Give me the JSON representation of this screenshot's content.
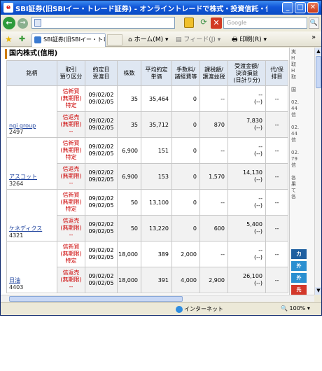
{
  "window": {
    "title": "SBI証券(旧SBIイー・トレード証券) - オンライントレードで株式・投資信託・債券を - Wind...",
    "app_icon": "e"
  },
  "address_bar": {
    "url": "",
    "search_placeholder": "Google",
    "refresh_glyph": "⟳",
    "stop_glyph": "✕",
    "search_go_glyph": "🔍"
  },
  "toolbar": {
    "tab_label": "SBI証券(旧SBIイー・トレー...",
    "home_label": "ホーム(M)",
    "feed_label": "フィード(J)",
    "print_label": "印刷(R)",
    "more_glyph": "»"
  },
  "section_title": "国内株式(信用)",
  "table": {
    "headers": [
      "銘柄",
      "取引\n預り区分",
      "約定日\n受渡日",
      "株数",
      "平均約定\n単価",
      "手数料/\n諸経費等",
      "課税額/\n譲渡益税",
      "受渡金額/\n決済損益\n(日計り分)",
      "代/保\n排目"
    ],
    "rows": [
      {
        "name": "ngi group",
        "code": "2497",
        "kind": "信新買\n(無期限)\n特定",
        "dates": "09/02/02\n09/02/05",
        "shares": "35",
        "price": "35,464",
        "fee": "0",
        "tax": "--",
        "settle": "--\n(--)",
        "flag": "--"
      },
      {
        "name": "",
        "code": "",
        "kind": "信返売\n(無期限)\n--",
        "dates": "09/02/02\n09/02/05",
        "shares": "35",
        "price": "35,712",
        "fee": "0",
        "tax": "870",
        "settle": "7,830\n(--)",
        "flag": "--"
      },
      {
        "name": "アスコット",
        "code": "3264",
        "kind": "信新買\n(無期限)\n特定",
        "dates": "09/02/02\n09/02/05",
        "shares": "6,900",
        "price": "151",
        "fee": "0",
        "tax": "--",
        "settle": "--\n(--)",
        "flag": "--"
      },
      {
        "name": "",
        "code": "",
        "kind": "信返売\n(無期限)\n--",
        "dates": "09/02/02\n09/02/05",
        "shares": "6,900",
        "price": "153",
        "fee": "0",
        "tax": "1,570",
        "settle": "14,130\n(--)",
        "flag": "--"
      },
      {
        "name": "ケネディクス",
        "code": "4321",
        "kind": "信新買\n(無期限)\n特定",
        "dates": "09/02/02\n09/02/05",
        "shares": "50",
        "price": "13,100",
        "fee": "0",
        "tax": "--",
        "settle": "--\n(--)",
        "flag": "--"
      },
      {
        "name": "",
        "code": "",
        "kind": "信返売\n(無期限)\n--",
        "dates": "09/02/02\n09/02/05",
        "shares": "50",
        "price": "13,220",
        "fee": "0",
        "tax": "600",
        "settle": "5,400\n(--)",
        "flag": "--"
      },
      {
        "name": "日油",
        "code": "4403",
        "kind": "信新買\n(無期限)\n特定",
        "dates": "09/02/02\n09/02/05",
        "shares": "18,000",
        "price": "389",
        "fee": "2,000",
        "tax": "--",
        "settle": "--\n(--)",
        "flag": "--"
      },
      {
        "name": "",
        "code": "",
        "kind": "信返売\n(無期限)\n--",
        "dates": "09/02/02\n09/02/05",
        "shares": "18,000",
        "price": "391",
        "fee": "4,000",
        "tax": "2,900",
        "settle": "26,100\n(--)",
        "flag": "--"
      }
    ]
  },
  "side_panel": {
    "text": "実\nH\n取\nH\n取\n\n国\n\n02.\n44\n信\n\n02.\n44\n信\n\n02.\n79\n信\n\n各\n果\nて\n各",
    "buttons": [
      {
        "label": "力",
        "color": "#1f5fa0"
      },
      {
        "label": "外",
        "color": "#2a8fd0"
      },
      {
        "label": "外",
        "color": "#2a8fd0"
      },
      {
        "label": "先",
        "color": "#d3382a"
      },
      {
        "label": "米",
        "color": "#2a8fd0"
      }
    ]
  },
  "status_bar": {
    "zone": "インターネット",
    "zoom": "100%"
  }
}
